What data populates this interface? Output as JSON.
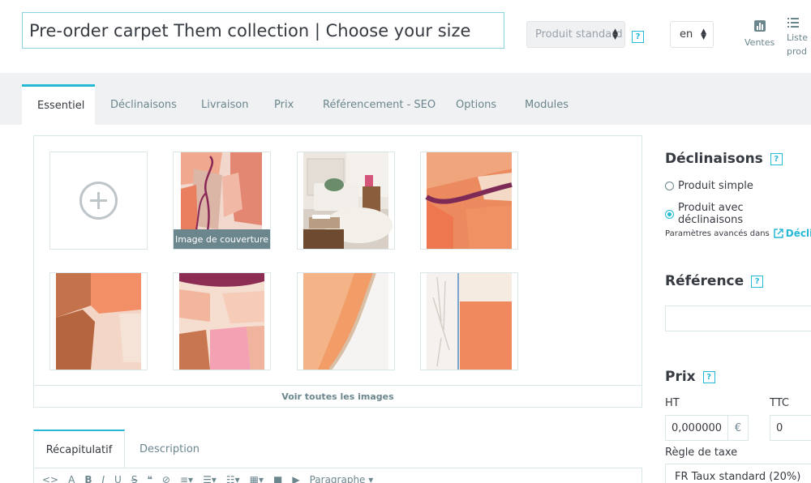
{
  "header": {
    "product_name": "Pre-order carpet Them collection | Choose your size",
    "product_type": "Produit standard",
    "language": "en",
    "help": "?",
    "actions": {
      "sales": "Ventes",
      "list_line1": "Liste",
      "list_line2": "prod"
    }
  },
  "tabs": [
    {
      "label": "Essentiel"
    },
    {
      "label": "Déclinaisons"
    },
    {
      "label": "Livraison"
    },
    {
      "label": "Prix"
    },
    {
      "label": "Référencement - SEO"
    },
    {
      "label": "Options"
    },
    {
      "label": "Modules"
    }
  ],
  "images": {
    "cover_label": "Image de couverture",
    "see_all": "Voir toutes les images"
  },
  "summary_tabs": [
    {
      "label": "Récapitulatif"
    },
    {
      "label": "Description"
    }
  ],
  "editor": {
    "paragraph_select": "Paragraphe"
  },
  "right": {
    "combinations": {
      "title": "Déclinaisons",
      "simple": "Produit simple",
      "with_combinations": "Produit avec déclinaisons",
      "advanced": "Paramètres avancés dans",
      "advanced_link": "Déclin"
    },
    "reference": {
      "title": "Référence",
      "value": ""
    },
    "price": {
      "title": "Prix",
      "ht_label": "HT",
      "ttc_label": "TTC",
      "ht_value": "0,000000",
      "currency": "€",
      "ttc_value": "0",
      "tax_rule_label": "Règle de taxe",
      "tax_rule_value": "FR Taux standard (20%)"
    }
  },
  "colors": {
    "accent": "#25b9d7",
    "muted": "#6c868e",
    "text": "#363a41",
    "tab_bg": "#eff1f2"
  }
}
